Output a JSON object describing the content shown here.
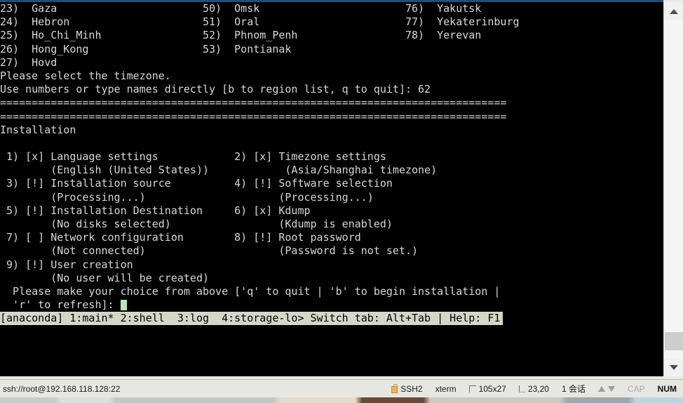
{
  "window": {
    "terminal_columns": 105,
    "terminal_rows": 27
  },
  "terminal": {
    "timezone_list": {
      "columns": [
        [
          "23)  Gaza",
          "24)  Hebron",
          "25)  Ho_Chi_Minh",
          "26)  Hong_Kong",
          "27)  Hovd"
        ],
        [
          "50)  Omsk",
          "51)  Oral",
          "52)  Phnom_Penh",
          "53)  Pontianak"
        ],
        [
          "76)  Yakutsk",
          "77)  Yekaterinburg",
          "78)  Yerevan"
        ]
      ]
    },
    "lines": [
      "23)  Gaza                       50)  Omsk                       76)  Yakutsk",
      "24)  Hebron                     51)  Oral                       77)  Yekaterinburg",
      "25)  Ho_Chi_Minh                52)  Phnom_Penh                 78)  Yerevan",
      "26)  Hong_Kong                  53)  Pontianak",
      "27)  Hovd",
      "Please select the timezone.",
      "Use numbers or type names directly [b to region list, q to quit]: 62",
      "================================================================================",
      "================================================================================",
      "Installation",
      "",
      " 1) [x] Language settings            2) [x] Timezone settings",
      "        (English (United States))            (Asia/Shanghai timezone)",
      " 3) [!] Installation source          4) [!] Software selection",
      "        (Processing...)                     (Processing...)",
      " 5) [!] Installation Destination     6) [x] Kdump",
      "        (No disks selected)                 (Kdump is enabled)",
      " 7) [ ] Network configuration        8) [!] Root password",
      "        (Not connected)                     (Password is not set.)",
      " 9) [!] User creation",
      "        (No user will be created)",
      "  Please make your choice from above ['q' to quit | 'b' to begin installation |",
      "  'r' to refresh]: "
    ],
    "prompt": {
      "select_timezone_text": "Please select the timezone.",
      "input_hint": "Use numbers or type names directly [b to region list, q to quit]: ",
      "typed_value": "62",
      "separator": "================================================================================",
      "section_title": "Installation",
      "choice_line_1": "  Please make your choice from above ['q' to quit | 'b' to begin installation |",
      "choice_line_2": "  'r' to refresh]: "
    },
    "menu_items": [
      {
        "num": "1)",
        "state": "[x]",
        "label": "Language settings",
        "detail": "(English (United States))"
      },
      {
        "num": "2)",
        "state": "[x]",
        "label": "Timezone settings",
        "detail": "(Asia/Shanghai timezone)"
      },
      {
        "num": "3)",
        "state": "[!]",
        "label": "Installation source",
        "detail": "(Processing...)"
      },
      {
        "num": "4)",
        "state": "[!]",
        "label": "Software selection",
        "detail": "(Processing...)"
      },
      {
        "num": "5)",
        "state": "[!]",
        "label": "Installation Destination",
        "detail": "(No disks selected)"
      },
      {
        "num": "6)",
        "state": "[x]",
        "label": "Kdump",
        "detail": "(Kdump is enabled)"
      },
      {
        "num": "7)",
        "state": "[ ]",
        "label": "Network configuration",
        "detail": "(Not connected)"
      },
      {
        "num": "8)",
        "state": "[!]",
        "label": "Root password",
        "detail": "(Password is not set.)"
      },
      {
        "num": "9)",
        "state": "[!]",
        "label": "User creation",
        "detail": "(No user will be created)"
      }
    ],
    "tmux_status": "[anaconda] 1:main* 2:shell  3:log  4:storage-lo> Switch tab: Alt+Tab | Help: F1",
    "tmux_tabs": [
      "[anaconda]",
      "1:main*",
      "2:shell",
      "3:log",
      "4:storage-lo>"
    ],
    "tmux_hints": "Switch tab: Alt+Tab | Help: F1"
  },
  "statusbar": {
    "connection": "ssh://root@192.168.118.128:22",
    "protocol": "SSH2",
    "emulation": "xterm",
    "size": "105x27",
    "cursor": "23,20",
    "sessions": "1 会话",
    "cap": "CAP",
    "num": "NUM",
    "icons": {
      "lock": "lock-icon",
      "window": "window-size-icon",
      "caret": "cursor-position-icon",
      "up": "scroll-up-icon",
      "down": "scroll-down-icon"
    }
  },
  "colors": {
    "terminal_bg": "#000000",
    "terminal_fg": "#d8d8d8",
    "tmux_bg": "#d6d6c8",
    "tmux_fg": "#000000",
    "cursor": "#b8e6b8",
    "accent": "#1f4e79",
    "chrome_bg": "#e6e6e2"
  }
}
